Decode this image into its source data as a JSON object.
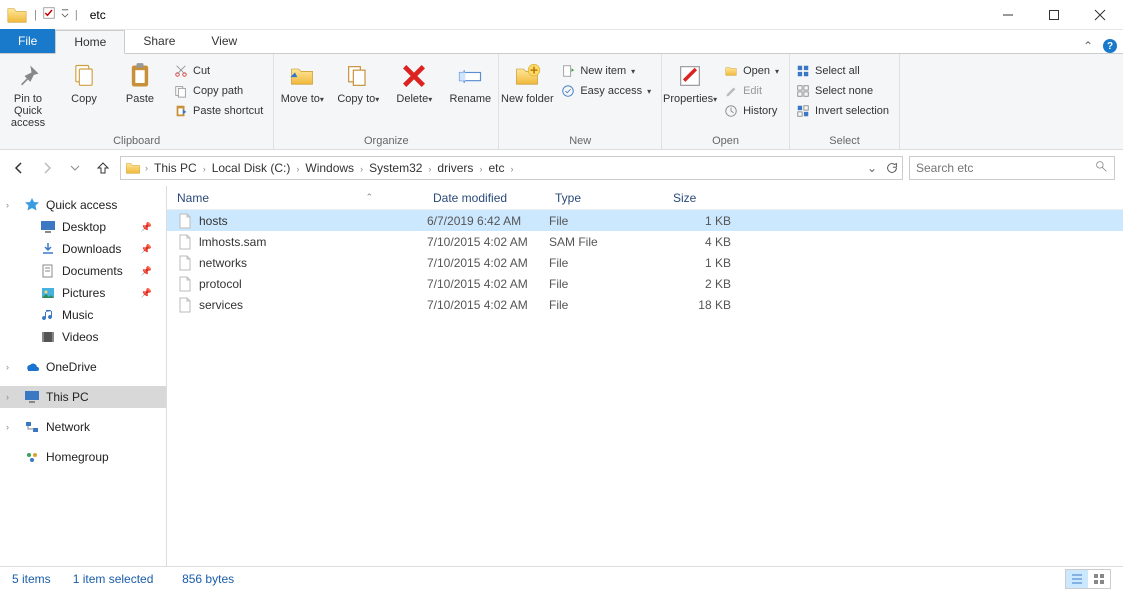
{
  "window": {
    "title": "etc"
  },
  "tabs": {
    "file": "File",
    "home": "Home",
    "share": "Share",
    "view": "View"
  },
  "ribbon": {
    "clipboard": {
      "pin": "Pin to Quick access",
      "copy": "Copy",
      "paste": "Paste",
      "cut": "Cut",
      "copy_path": "Copy path",
      "paste_shortcut": "Paste shortcut",
      "label": "Clipboard"
    },
    "organize": {
      "move_to": "Move to",
      "copy_to": "Copy to",
      "delete": "Delete",
      "rename": "Rename",
      "label": "Organize"
    },
    "new": {
      "new_folder": "New folder",
      "new_item": "New item",
      "easy_access": "Easy access",
      "label": "New"
    },
    "open": {
      "properties": "Properties",
      "open": "Open",
      "edit": "Edit",
      "history": "History",
      "label": "Open"
    },
    "select": {
      "select_all": "Select all",
      "select_none": "Select none",
      "invert": "Invert selection",
      "label": "Select"
    }
  },
  "breadcrumb": [
    "This PC",
    "Local Disk (C:)",
    "Windows",
    "System32",
    "drivers",
    "etc"
  ],
  "search": {
    "placeholder": "Search etc"
  },
  "sidebar": {
    "quick_access": "Quick access",
    "desktop": "Desktop",
    "downloads": "Downloads",
    "documents": "Documents",
    "pictures": "Pictures",
    "music": "Music",
    "videos": "Videos",
    "onedrive": "OneDrive",
    "this_pc": "This PC",
    "network": "Network",
    "homegroup": "Homegroup"
  },
  "columns": {
    "name": "Name",
    "date": "Date modified",
    "type": "Type",
    "size": "Size"
  },
  "files": [
    {
      "name": "hosts",
      "date": "6/7/2019 6:42 AM",
      "type": "File",
      "size": "1 KB",
      "selected": true
    },
    {
      "name": "lmhosts.sam",
      "date": "7/10/2015 4:02 AM",
      "type": "SAM File",
      "size": "4 KB",
      "selected": false
    },
    {
      "name": "networks",
      "date": "7/10/2015 4:02 AM",
      "type": "File",
      "size": "1 KB",
      "selected": false
    },
    {
      "name": "protocol",
      "date": "7/10/2015 4:02 AM",
      "type": "File",
      "size": "2 KB",
      "selected": false
    },
    {
      "name": "services",
      "date": "7/10/2015 4:02 AM",
      "type": "File",
      "size": "18 KB",
      "selected": false
    }
  ],
  "status": {
    "items": "5 items",
    "selected": "1 item selected",
    "size": "856 bytes"
  }
}
